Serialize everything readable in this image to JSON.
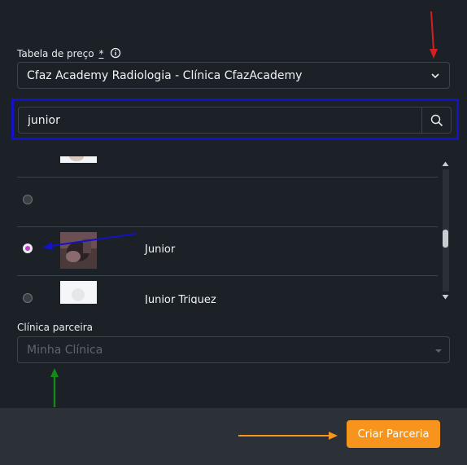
{
  "price_table": {
    "label": "Tabela de preço",
    "required_mark": "*",
    "selected": "Cfaz Academy Radiologia - Clínica CfazAcademy"
  },
  "search": {
    "value": "junior"
  },
  "results": [
    {
      "name": "",
      "checked": false
    },
    {
      "name": "",
      "checked": false
    },
    {
      "name": "Junior",
      "checked": true
    },
    {
      "name": "Junior Triquez",
      "checked": false
    }
  ],
  "partner_clinic": {
    "label": "Clínica parceira",
    "placeholder": "Minha Clínica"
  },
  "footer": {
    "create_label": "Criar Parceria"
  },
  "colors": {
    "accent": "#f7941d",
    "annotation_red": "#d42020",
    "annotation_blue": "#1212c8",
    "annotation_green": "#138a13",
    "annotation_orange": "#f7941d",
    "radio_checked": "#c23fc7"
  }
}
